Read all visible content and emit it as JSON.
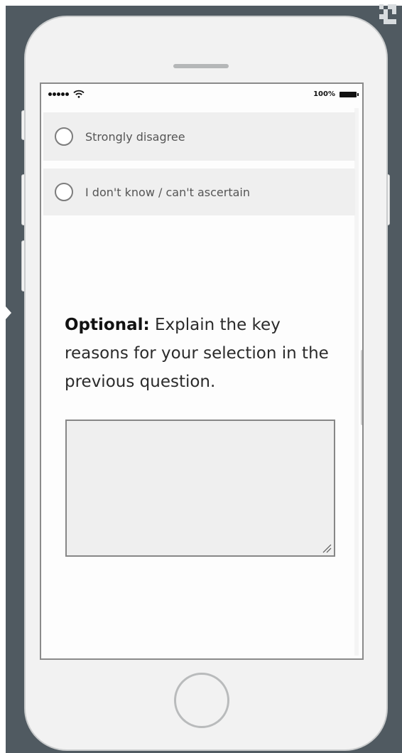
{
  "status_bar": {
    "signal": "signal-dots-icon",
    "wifi": "wifi-icon",
    "battery_percent": "100%",
    "battery": "battery-icon"
  },
  "survey": {
    "options": [
      {
        "label": "Strongly disagree",
        "selected": false
      },
      {
        "label": "I don't know / can't ascertain",
        "selected": false
      }
    ],
    "optional_prompt": {
      "bold": "Optional:",
      "text": " Explain the key reasons for your selection in the previous question."
    },
    "response_value": ""
  },
  "colors": {
    "backdrop": "#505a61",
    "phone_body": "#f2f2f2",
    "option_background": "#efefef",
    "textarea_background": "#efefef"
  },
  "device": {
    "home_button": "home-button-icon",
    "speaker": "speaker-grille-icon"
  }
}
